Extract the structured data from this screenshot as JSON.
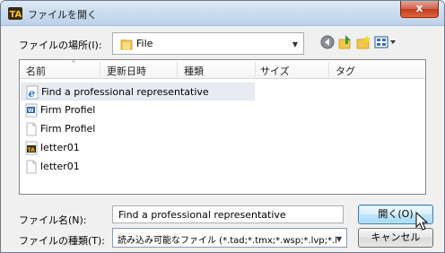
{
  "window": {
    "title": "ファイルを開く",
    "close_label": "x"
  },
  "location": {
    "label": "ファイルの場所(I):",
    "value": "File"
  },
  "columns": [
    "名前",
    "更新日時",
    "種類",
    "サイズ",
    "タグ"
  ],
  "files": [
    {
      "name": "Find a professional representative",
      "icon": "ie-document-icon"
    },
    {
      "name": "Firm Profiel",
      "icon": "word-document-icon"
    },
    {
      "name": "Firm Profiel",
      "icon": "blank-document-icon"
    },
    {
      "name": "letter01",
      "icon": "tad-document-icon"
    },
    {
      "name": "letter01",
      "icon": "blank-document-icon"
    }
  ],
  "filename": {
    "label": "ファイル名(N):",
    "value": "Find a professional representative"
  },
  "filetype": {
    "label": "ファイルの種類(T):",
    "value": "読み込み可能なファイル (*.tad;*.tmx;*.wsp;*.lvp;*.l"
  },
  "buttons": {
    "open": "開く(O)",
    "cancel": "キャンセル"
  }
}
